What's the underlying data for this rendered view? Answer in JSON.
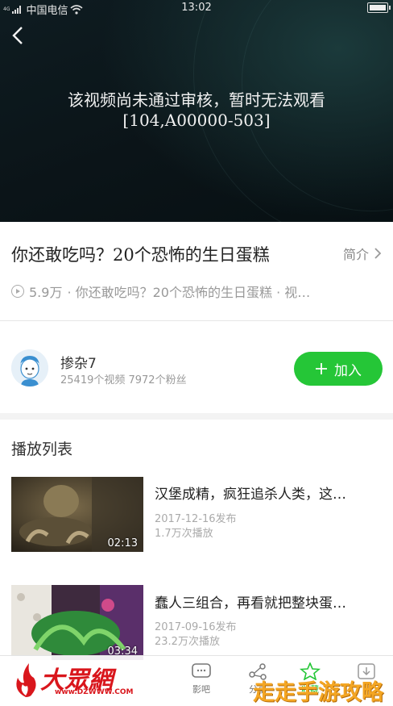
{
  "status_bar": {
    "signal": "4G",
    "carrier": "中国电信",
    "time": "13:02"
  },
  "player": {
    "error_line1": "该视频尚未通过审核，暂时无法观看",
    "error_line2": "[104,A00000-503]"
  },
  "video": {
    "title": "你还敢吃吗？20个恐怖的生日蛋糕",
    "intro_label": "简介",
    "play_count": "5.9万",
    "subtitle": "· 你还敢吃吗？20个恐怖的生日蛋糕 · 视…"
  },
  "uploader": {
    "name": "掺杂7",
    "stats": "25419个视频 7972个粉丝",
    "join_label": "加入"
  },
  "playlist": {
    "header": "播放列表",
    "items": [
      {
        "title": "汉堡成精，疯狂追杀人类，这…",
        "date": "2017-12-16发布",
        "plays": "1.7万次播放",
        "duration": "02:13"
      },
      {
        "title": "蠢人三组合，再看就把整块蛋…",
        "date": "2017-09-16发布",
        "plays": "23.2万次播放",
        "duration": "03:34"
      }
    ]
  },
  "tabbar": {
    "tabs": [
      {
        "label": "影吧"
      },
      {
        "label": "分享"
      },
      {
        "label": "收藏"
      }
    ]
  },
  "watermarks": {
    "left_brand": "大眾網",
    "left_url": "www.DZWWW.COM",
    "right_brand": "走走手游攻略"
  },
  "colors": {
    "accent_green": "#25c637",
    "video_bg": "#0b1418",
    "brand_red": "#d9161c",
    "brand_orange": "#f4a623"
  }
}
